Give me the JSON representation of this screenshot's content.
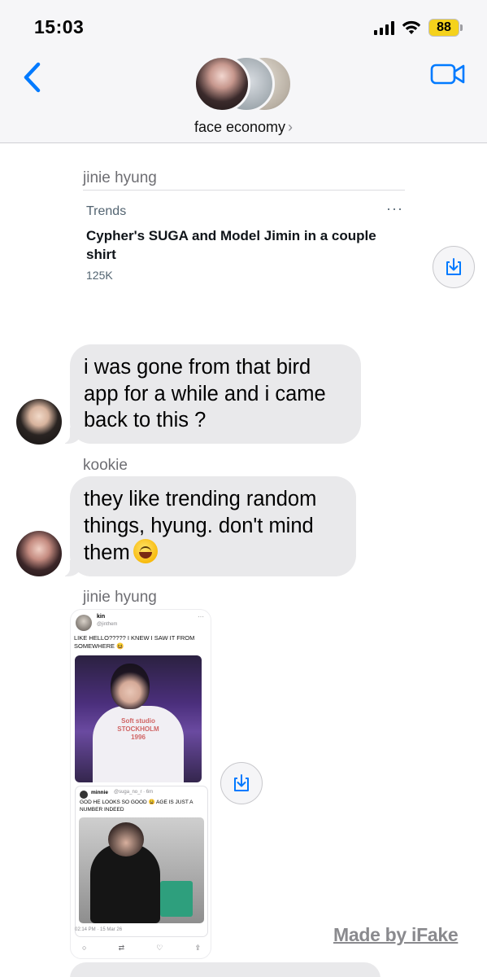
{
  "status_bar": {
    "time": "15:03",
    "battery": "88"
  },
  "header": {
    "back_icon": "chevron-left-icon",
    "video_icon": "video-camera-icon",
    "group_name": "face economy",
    "group_chevron": "›"
  },
  "messages": {
    "m1": {
      "sender": "jinie hyung"
    },
    "trend_card": {
      "label": "Trends",
      "more": "···",
      "title": "Cypher's SUGA and Model Jimin in a couple shirt",
      "count": "125K"
    },
    "m2": {
      "text": "i was gone from that bird app for a while and i came back to this ?"
    },
    "m3": {
      "sender": "kookie",
      "text": "they like trending random things, hyung. don't mind them"
    },
    "m4": {
      "sender": "jinie hyung",
      "tweet": {
        "name": "kin",
        "handle": "@jinthem",
        "text": "LIKE HELLO????? I KNEW I SAW IT FROM SOMEWHERE 😆",
        "photo_text": "Soft studio STOCKHOLM 1996",
        "quote_name": "minnie",
        "quote_handle": "@suga_no_r · 6m",
        "quote_text": "GOD HE LOOKS SO GOOD 😩 AGE IS JUST A NUMBER INDEED",
        "date": "02:14 PM · 15 Mar 26"
      }
    }
  },
  "watermark": "Made by iFake",
  "colors": {
    "accent": "#007aff",
    "bubble": "#e9e9eb",
    "battery": "#f5d21c"
  }
}
